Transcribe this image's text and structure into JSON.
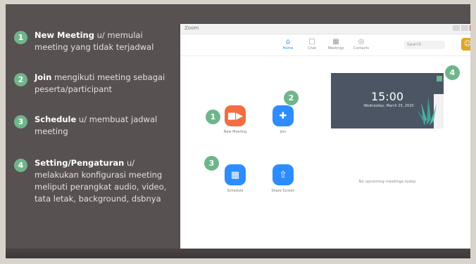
{
  "legend": [
    {
      "number": "1",
      "title": "New Meeting",
      "description": " u/ memulai meeting yang tidak terjadwal"
    },
    {
      "number": "2",
      "title": "Join",
      "description": " mengikuti meeting sebagai peserta/participant"
    },
    {
      "number": "3",
      "title": "Schedule",
      "description": " u/ membuat jadwal meeting"
    },
    {
      "number": "4",
      "title": "Setting/Pengaturan",
      "description": " u/ melakukan konfigurasi meeting meliputi perangkat audio, video, tata letak, background, dsbnya"
    }
  ],
  "window": {
    "title": "Zoom"
  },
  "nav": {
    "tabs": [
      {
        "label": "Home",
        "icon": "home-icon"
      },
      {
        "label": "Chat",
        "icon": "chat-icon"
      },
      {
        "label": "Meetings",
        "icon": "calendar-icon"
      },
      {
        "label": "Contacts",
        "icon": "contacts-icon"
      }
    ],
    "search_placeholder": "Search",
    "active_tab": "Home"
  },
  "actions": [
    {
      "label": "New Meeting",
      "icon": "video-camera-icon",
      "marker": "1",
      "color": "#f26d41"
    },
    {
      "label": "Join",
      "icon": "plus-icon",
      "marker": "2",
      "color": "#2d8cff"
    },
    {
      "label": "Schedule",
      "icon": "calendar-icon",
      "marker": "3",
      "color": "#2d8cff"
    },
    {
      "label": "Share Screen",
      "icon": "share-screen-icon",
      "marker": "",
      "color": "#2d8cff"
    }
  ],
  "settings_marker": "4",
  "clock": {
    "time": "15:00",
    "date": "Wednesday, March 25, 2020"
  },
  "upcoming_meetings_text": "No upcoming meetings today",
  "colors": {
    "accent": "#2d8cff",
    "new_meeting": "#f26d41",
    "badge": "#6fb58c",
    "slide_background": "#585151"
  }
}
